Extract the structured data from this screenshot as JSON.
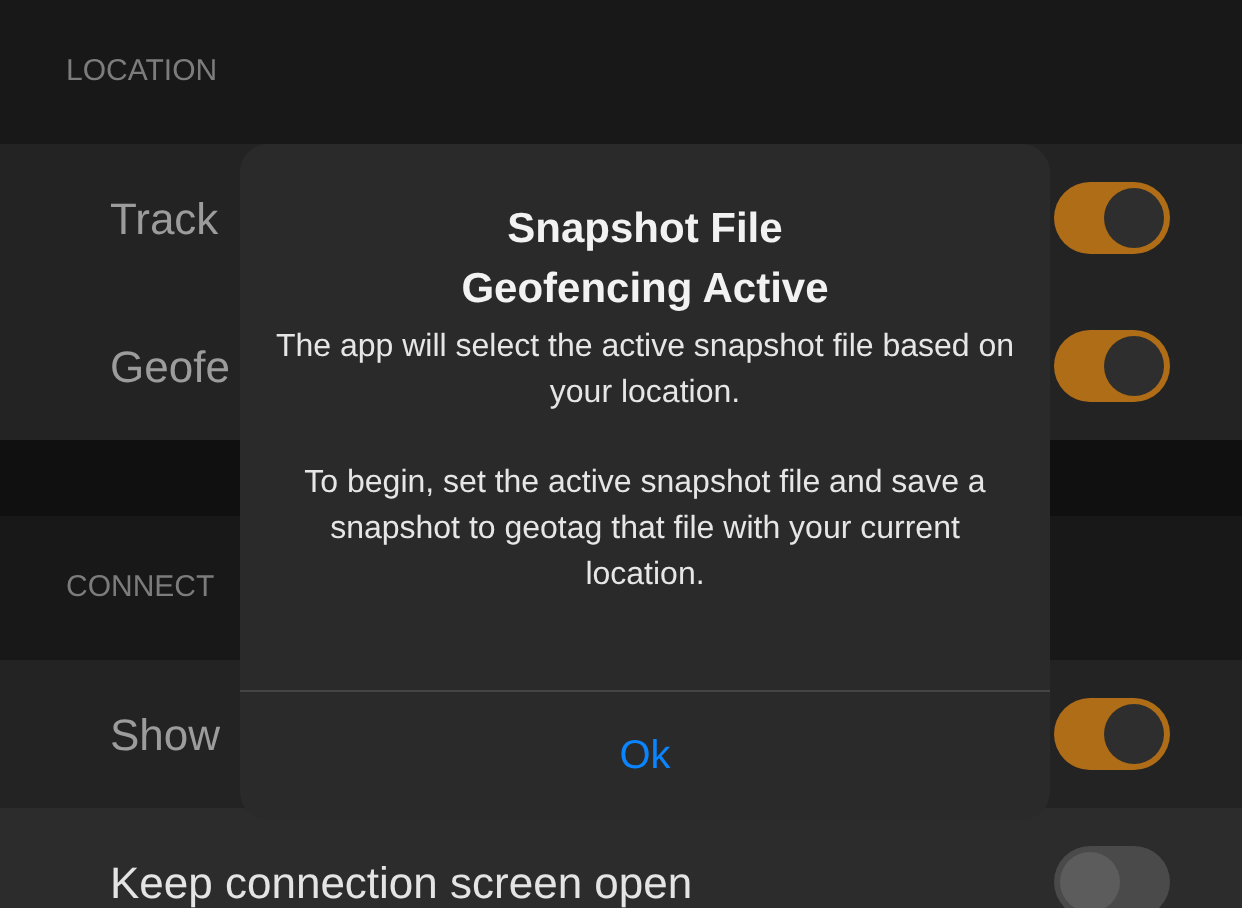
{
  "sections": [
    {
      "header": "LOCATION",
      "rows": [
        {
          "label": "Track",
          "on": true
        },
        {
          "label": "Geofe",
          "on": true
        }
      ]
    },
    {
      "header": "CONNECT",
      "rows": [
        {
          "label": "Show",
          "on": true
        },
        {
          "label": "Keep connection screen open",
          "on": false
        }
      ]
    }
  ],
  "dialog": {
    "title_lines": [
      "Snapshot File",
      "Geofencing Active"
    ],
    "paragraphs": [
      "The app will select the active snapshot file based on your location.",
      "To begin, set the active snapshot file and save a snapshot to geotag that file with your current location."
    ],
    "button": "Ok"
  }
}
